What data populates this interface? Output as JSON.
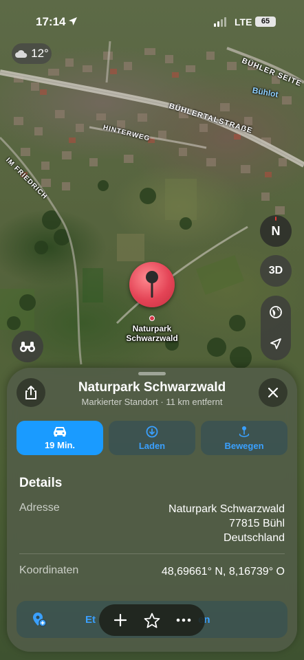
{
  "status_bar": {
    "time": "17:14",
    "network": "LTE",
    "battery": "65"
  },
  "weather": {
    "temperature": "12°",
    "icon": "cloud-icon"
  },
  "map": {
    "street_labels": [
      "BÜHLER SEITE",
      "Bühlot",
      "BÜHLERTALSTRAẞE",
      "HINTERWEG",
      "IM FRIEDRICH"
    ],
    "compass_label": "N",
    "view_toggle_label": "3D",
    "pin_label_line1": "Naturpark",
    "pin_label_line2": "Schwarzwald"
  },
  "sheet": {
    "title": "Naturpark Schwarzwald",
    "subtitle": "Markierter Standort · 11 km entfernt",
    "actions": [
      {
        "label": "19 Min.",
        "icon": "car-icon"
      },
      {
        "label": "Laden",
        "icon": "download-icon"
      },
      {
        "label": "Bewegen",
        "icon": "move-pin-icon"
      }
    ],
    "details_heading": "Details",
    "address_label": "Adresse",
    "address_lines": [
      "Naturpark Schwarzwald",
      "77815 Bühl",
      "Deutschland"
    ],
    "coordinates_label": "Koordinaten",
    "coordinates_value": "48,69661° N, 8,16739° O",
    "partial_row_left": "Et",
    "partial_row_right": "en"
  },
  "colors": {
    "accent": "#1a9bff",
    "pin": "#e44456"
  }
}
